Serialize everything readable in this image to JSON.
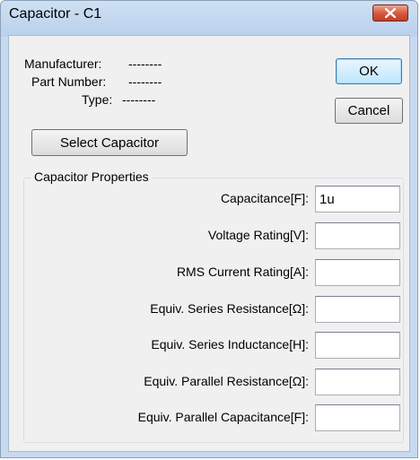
{
  "window": {
    "title": "Capacitor - C1"
  },
  "info": {
    "manufacturer_label": "Manufacturer:",
    "manufacturer_value": "--------",
    "part_number_label": "Part Number:",
    "part_number_value": "--------",
    "type_label": "Type:",
    "type_value": "--------"
  },
  "buttons": {
    "ok": "OK",
    "cancel": "Cancel",
    "select_capacitor": "Select Capacitor"
  },
  "properties": {
    "group_title": "Capacitor Properties",
    "items": [
      {
        "label": "Capacitance[F]:",
        "value": "1u"
      },
      {
        "label": "Voltage Rating[V]:",
        "value": ""
      },
      {
        "label": "RMS Current Rating[A]:",
        "value": ""
      },
      {
        "label": "Equiv. Series Resistance[Ω]:",
        "value": ""
      },
      {
        "label": "Equiv. Series Inductance[H]:",
        "value": ""
      },
      {
        "label": "Equiv. Parallel Resistance[Ω]:",
        "value": ""
      },
      {
        "label": "Equiv. Parallel Capacitance[F]:",
        "value": ""
      }
    ]
  },
  "icons": {
    "close": "close-icon"
  },
  "colors": {
    "title_bar": "#b9d1ec",
    "close_button": "#c94b33",
    "dialog_background": "#f0f0f0"
  }
}
